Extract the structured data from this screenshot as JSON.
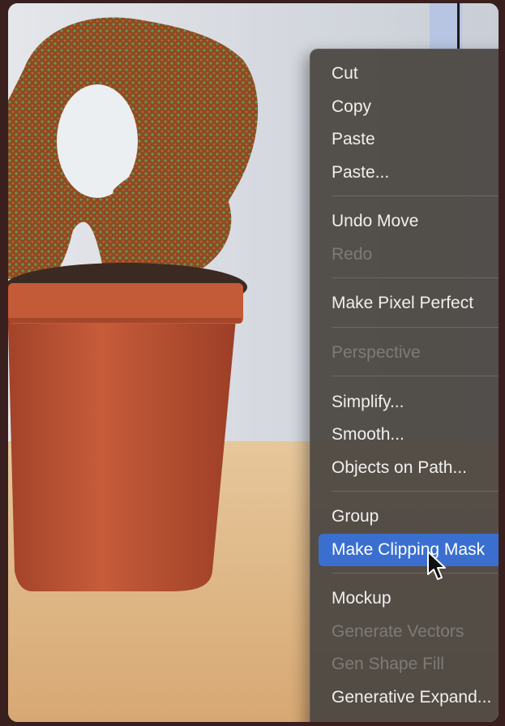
{
  "context_menu": {
    "items": [
      {
        "label": "Cut",
        "enabled": true,
        "highlighted": false
      },
      {
        "label": "Copy",
        "enabled": true,
        "highlighted": false
      },
      {
        "label": "Paste",
        "enabled": true,
        "highlighted": false
      },
      {
        "label": "Paste...",
        "enabled": true,
        "highlighted": false
      },
      {
        "label": "Undo Move",
        "enabled": true,
        "highlighted": false
      },
      {
        "label": "Redo",
        "enabled": false,
        "highlighted": false
      },
      {
        "label": "Make Pixel Perfect",
        "enabled": true,
        "highlighted": false
      },
      {
        "label": "Perspective",
        "enabled": false,
        "highlighted": false
      },
      {
        "label": "Simplify...",
        "enabled": true,
        "highlighted": false
      },
      {
        "label": "Smooth...",
        "enabled": true,
        "highlighted": false
      },
      {
        "label": "Objects on Path...",
        "enabled": true,
        "highlighted": false
      },
      {
        "label": "Group",
        "enabled": true,
        "highlighted": false
      },
      {
        "label": "Make Clipping Mask",
        "enabled": true,
        "highlighted": true
      },
      {
        "label": "Mockup",
        "enabled": true,
        "highlighted": false
      },
      {
        "label": "Generate Vectors",
        "enabled": false,
        "highlighted": false
      },
      {
        "label": "Gen Shape Fill",
        "enabled": false,
        "highlighted": false
      },
      {
        "label": "Generative Expand...",
        "enabled": true,
        "highlighted": false
      }
    ]
  },
  "canvas": {
    "icon": "cactus-photo"
  },
  "colors": {
    "menu_background": "#4a4642",
    "highlight": "#3a6fd0",
    "enabled_text": "#f1efed",
    "disabled_text": "#7e7a76",
    "page_border": "#3a1f1f"
  },
  "cursor": {
    "icon": "arrow-pointer-icon"
  }
}
